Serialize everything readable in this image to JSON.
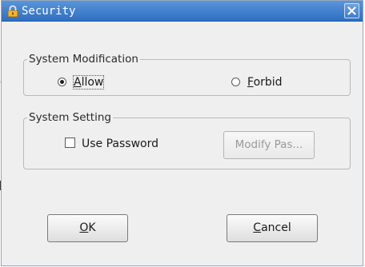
{
  "window": {
    "title": "Security",
    "lock_icon": "lock-icon",
    "close_icon": "close-icon"
  },
  "background_fragment": "o",
  "system_modification": {
    "legend": "System Modification",
    "options": [
      {
        "label": "Allow",
        "mnemonic": "A",
        "rest": "llow",
        "checked": true
      },
      {
        "label": "Forbid",
        "mnemonic": "F",
        "rest": "orbid",
        "checked": false
      }
    ]
  },
  "system_setting": {
    "legend": "System Setting",
    "use_password_label": "Use Password",
    "use_password_checked": false,
    "modify_button_label": "Modify Pas...",
    "modify_button_enabled": false
  },
  "buttons": {
    "ok": {
      "mnemonic": "O",
      "rest": "K"
    },
    "cancel": {
      "mnemonic": "C",
      "rest": "ancel"
    }
  },
  "colors": {
    "titlebar": "#3b7dd0",
    "window_bg": "#efefef",
    "disabled_text": "#9a9a9a"
  }
}
